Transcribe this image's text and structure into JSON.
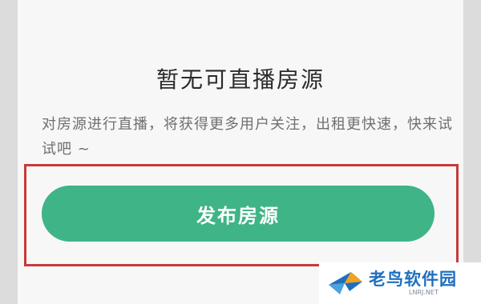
{
  "empty_state": {
    "title": "暂无可直播房源",
    "description": "对房源进行直播，将获得更多用户关注，出租更快速，快来试试吧 ~"
  },
  "actions": {
    "publish_label": "发布房源"
  },
  "watermark": {
    "name": "老鸟软件园",
    "url": "LNRJ.NET",
    "logo_icon": "bird-logo-icon"
  },
  "colors": {
    "accent": "#3fb486",
    "highlight_border": "#c83a3a",
    "watermark_text": "#1f6fbf"
  }
}
